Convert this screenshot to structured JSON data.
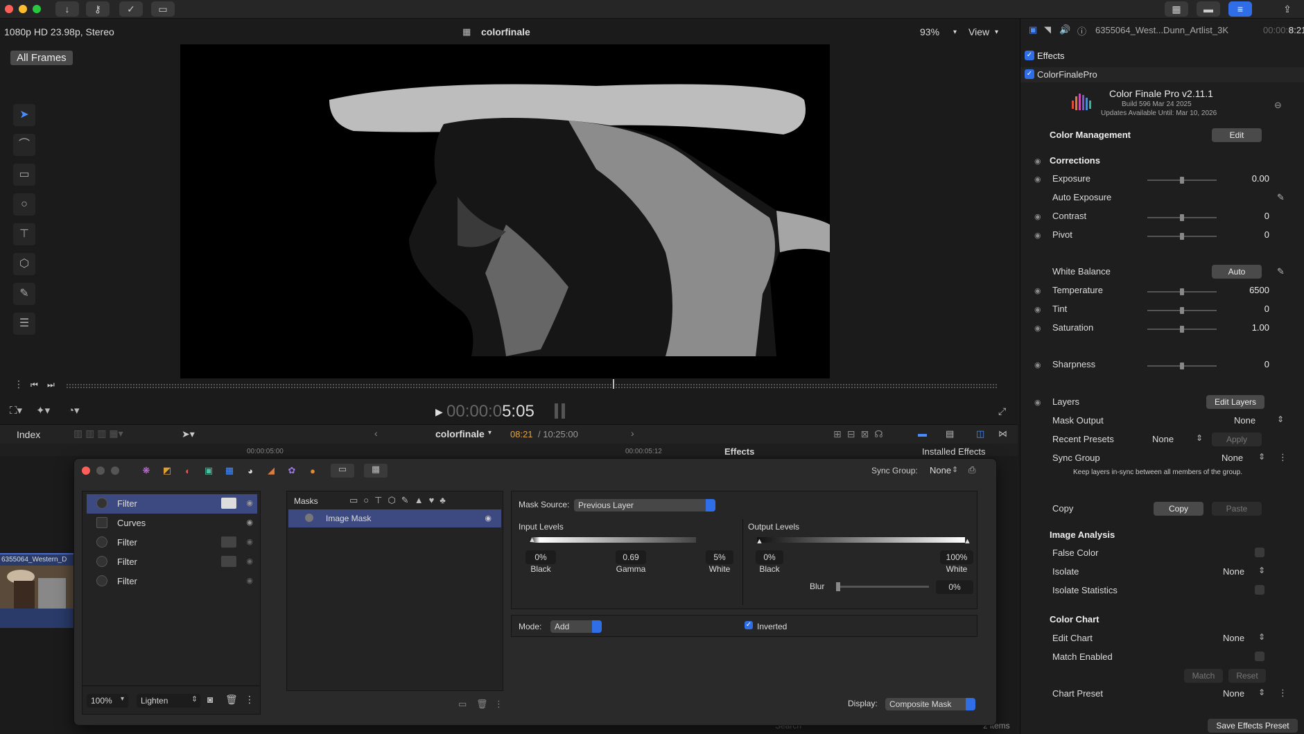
{
  "viewer": {
    "format": "1080p HD 23.98p, Stereo",
    "project": "colorfinale",
    "zoom": "93%",
    "view": "View",
    "all_frames": "All Frames",
    "timecode_dim": "00:00:0",
    "timecode_bright": "5:05"
  },
  "timeline": {
    "index": "Index",
    "project": "colorfinale",
    "position": "08:21",
    "duration": "/ 10:25:00",
    "ruler_a": "00:00:05:00",
    "ruler_b": "00:00:05:12",
    "effects": "Effects",
    "installed": "Installed Effects",
    "clip_name": "6355064_Western_D",
    "items": "2 items",
    "search": "Search"
  },
  "inspector": {
    "clip": "6355064_West...Dunn_Artlist_3K",
    "clip_tc_dim": "00:00:0",
    "clip_tc": "8:21",
    "effects_label": "Effects",
    "plugin_label": "ColorFinalePro",
    "plugin_title": "Color Finale Pro v2.11.1",
    "plugin_build": "Build 596 Mar 24 2025",
    "plugin_updates": "Updates Available Until: Mar 10, 2026",
    "color_management": "Color Management",
    "edit": "Edit",
    "corrections": "Corrections",
    "exposure": "Exposure",
    "exposure_val": "0.00",
    "auto_exposure": "Auto Exposure",
    "contrast": "Contrast",
    "contrast_val": "0",
    "pivot": "Pivot",
    "pivot_val": "0",
    "white_balance": "White Balance",
    "auto": "Auto",
    "temperature": "Temperature",
    "temperature_val": "6500",
    "tint": "Tint",
    "tint_val": "0",
    "saturation": "Saturation",
    "saturation_val": "1.00",
    "sharpness": "Sharpness",
    "sharpness_val": "0",
    "layers": "Layers",
    "edit_layers": "Edit Layers",
    "mask_output": "Mask Output",
    "mask_output_val": "None",
    "recent_presets": "Recent Presets",
    "recent_presets_val": "None",
    "apply": "Apply",
    "sync_group": "Sync Group",
    "sync_group_val": "None",
    "sync_note": "Keep layers in-sync between all members of the group.",
    "copy_label": "Copy",
    "copy_btn": "Copy",
    "paste": "Paste",
    "image_analysis": "Image Analysis",
    "false_color": "False Color",
    "isolate": "Isolate",
    "isolate_val": "None",
    "isolate_stats": "Isolate Statistics",
    "color_chart": "Color Chart",
    "edit_chart": "Edit Chart",
    "edit_chart_val": "None",
    "match_enabled": "Match Enabled",
    "match": "Match",
    "reset": "Reset",
    "chart_preset": "Chart Preset",
    "chart_preset_val": "None",
    "save_preset": "Save Effects Preset"
  },
  "panel": {
    "sync_group": "Sync Group:",
    "sync_group_val": "None",
    "layers": [
      {
        "name": "Filter"
      },
      {
        "name": "Curves"
      },
      {
        "name": "Filter"
      },
      {
        "name": "Filter"
      },
      {
        "name": "Filter"
      }
    ],
    "opacity": "100%",
    "blend": "Lighten",
    "masks_title": "Masks",
    "mask_item": "Image Mask",
    "mask_source_label": "Mask Source:",
    "mask_source": "Previous Layer",
    "input_levels": "Input Levels",
    "in_black": "0%",
    "in_gamma": "0.69",
    "in_white": "5%",
    "black": "Black",
    "gamma": "Gamma",
    "white": "White",
    "output_levels": "Output Levels",
    "out_black": "0%",
    "out_white": "100%",
    "blur": "Blur",
    "blur_val": "0%",
    "mode_label": "Mode:",
    "mode": "Add",
    "inverted": "Inverted",
    "display_label": "Display:",
    "display": "Composite Mask"
  }
}
